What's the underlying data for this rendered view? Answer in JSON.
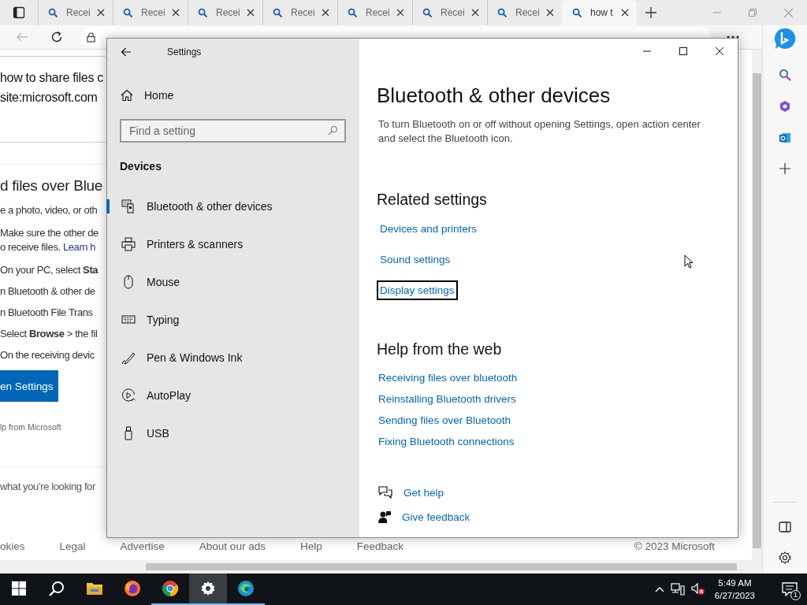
{
  "browser": {
    "tabs": [
      {
        "label": "Recei",
        "selected": false
      },
      {
        "label": "Recei",
        "selected": false
      },
      {
        "label": "Recei",
        "selected": false
      },
      {
        "label": "Recei",
        "selected": false
      },
      {
        "label": "Recei",
        "selected": false
      },
      {
        "label": "Recei",
        "selected": false
      },
      {
        "label": "Recei",
        "selected": false
      },
      {
        "label": "how t",
        "selected": true
      }
    ],
    "page": {
      "search_query": [
        "how to share files c",
        "site:microsoft.com"
      ],
      "heading": "d files over Blue",
      "lines": [
        {
          "text": "e a photo, video, or oth"
        },
        {
          "text": "Make sure the other de"
        },
        {
          "text": "o receive files. ",
          "link": "Learn h"
        },
        {
          "text": "On your PC, select **Sta**"
        },
        {
          "text": "n Bluetooth & other de"
        },
        {
          "text": "n Bluetooth File Trans"
        },
        {
          "text": "Select **Browse** > the fil"
        },
        {
          "text": "On the receiving devic"
        }
      ],
      "button": "en Settings",
      "help_note": "lp from Microsoft",
      "feedback_prompt": "what you’re looking for",
      "footer": [
        "okies",
        "Legal",
        "Advertise",
        "About our ads",
        "Help",
        "Feedback"
      ],
      "copyright": "© 2023 Microsoft"
    }
  },
  "settings_window": {
    "title": "Settings",
    "home": "Home",
    "search": {
      "placeholder": "Find a setting"
    },
    "section": "Devices",
    "nav": [
      {
        "label": "Bluetooth & other devices",
        "kind": "bluetooth",
        "selected": true
      },
      {
        "label": "Printers & scanners",
        "kind": "printer",
        "selected": false
      },
      {
        "label": "Mouse",
        "kind": "mouse",
        "selected": false
      },
      {
        "label": "Typing",
        "kind": "keyboard",
        "selected": false
      },
      {
        "label": "Pen & Windows Ink",
        "kind": "pen",
        "selected": false
      },
      {
        "label": "AutoPlay",
        "kind": "autoplay",
        "selected": false
      },
      {
        "label": "USB",
        "kind": "usb",
        "selected": false
      }
    ],
    "heading": "Bluetooth & other devices",
    "description": "To turn Bluetooth on or off without opening Settings, open action center and select the Bluetooth icon.",
    "related": {
      "title": "Related settings",
      "links": [
        {
          "label": "Devices and printers",
          "focused": false
        },
        {
          "label": "Sound settings",
          "focused": false
        },
        {
          "label": "Display settings",
          "focused": true
        }
      ]
    },
    "help": {
      "title": "Help from the web",
      "links": [
        "Receiving files over bluetooth",
        "Reinstalling Bluetooth drivers",
        "Sending files over Bluetooth",
        "Fixing Bluetooth connections"
      ]
    },
    "actions": [
      {
        "label": "Get help",
        "kind": "chat"
      },
      {
        "label": "Give feedback",
        "kind": "feedback"
      }
    ]
  },
  "taskbar": {
    "apps": [
      {
        "kind": "start",
        "running": false,
        "selected": false
      },
      {
        "kind": "search",
        "running": false,
        "selected": false
      },
      {
        "kind": "explorer",
        "running": false,
        "selected": false
      },
      {
        "kind": "firefox",
        "running": false,
        "selected": false
      },
      {
        "kind": "chrome",
        "running": true,
        "selected": false
      },
      {
        "kind": "settings",
        "running": true,
        "selected": true
      },
      {
        "kind": "edge",
        "running": true,
        "selected": false
      }
    ],
    "time": "5:49 AM",
    "date": "6/27/2023",
    "notifications": "1"
  }
}
